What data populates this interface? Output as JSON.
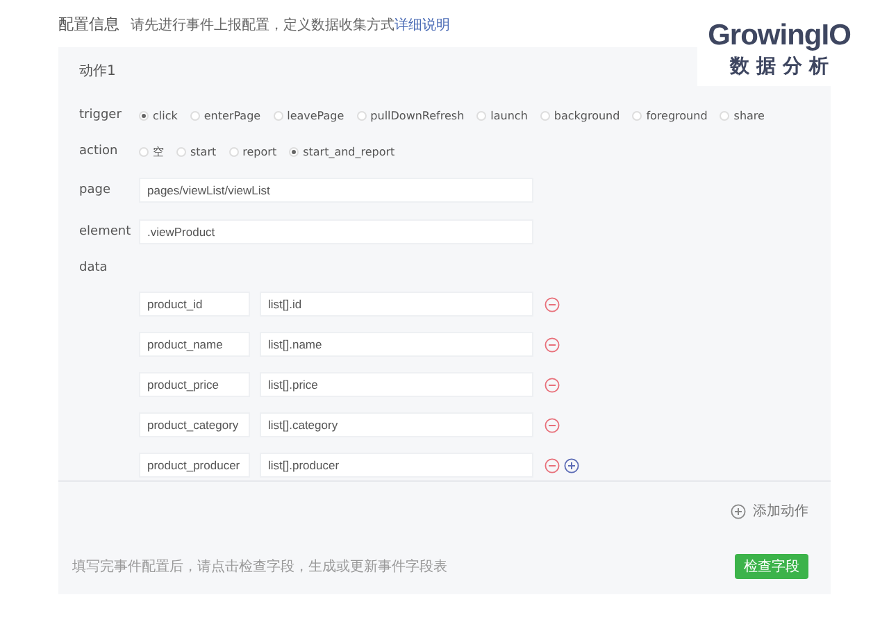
{
  "header": {
    "title": "配置信息",
    "hint": "请先进行事件上报配置，定义数据收集方式",
    "hint_link": "详细说明"
  },
  "logo": {
    "name": "GrowingIO",
    "tagline": "数 据 分 析"
  },
  "action": {
    "title": "动作1",
    "trigger": {
      "label": "trigger",
      "options": [
        {
          "label": "click",
          "selected": true
        },
        {
          "label": "enterPage",
          "selected": false
        },
        {
          "label": "leavePage",
          "selected": false
        },
        {
          "label": "pullDownRefresh",
          "selected": false
        },
        {
          "label": "launch",
          "selected": false
        },
        {
          "label": "background",
          "selected": false
        },
        {
          "label": "foreground",
          "selected": false
        },
        {
          "label": "share",
          "selected": false
        }
      ]
    },
    "type": {
      "label": "action",
      "options": [
        {
          "label": "空",
          "selected": false
        },
        {
          "label": "start",
          "selected": false
        },
        {
          "label": "report",
          "selected": false
        },
        {
          "label": "start_and_report",
          "selected": true
        }
      ]
    },
    "page": {
      "label": "page",
      "value": "pages/viewList/viewList"
    },
    "element": {
      "label": "element",
      "value": ".viewProduct"
    },
    "data": {
      "label": "data",
      "rows": [
        {
          "key": "product_id",
          "value": "list[].id",
          "addable": false
        },
        {
          "key": "product_name",
          "value": "list[].name",
          "addable": false
        },
        {
          "key": "product_price",
          "value": "list[].price",
          "addable": false
        },
        {
          "key": "product_category",
          "value": "list[].category",
          "addable": false
        },
        {
          "key": "product_producer",
          "value": "list[].producer",
          "addable": true
        }
      ]
    }
  },
  "add_action": "添加动作",
  "footer": {
    "note": "填写完事件配置后，请点击检查字段，生成或更新事件字段表",
    "button": "检查字段"
  }
}
